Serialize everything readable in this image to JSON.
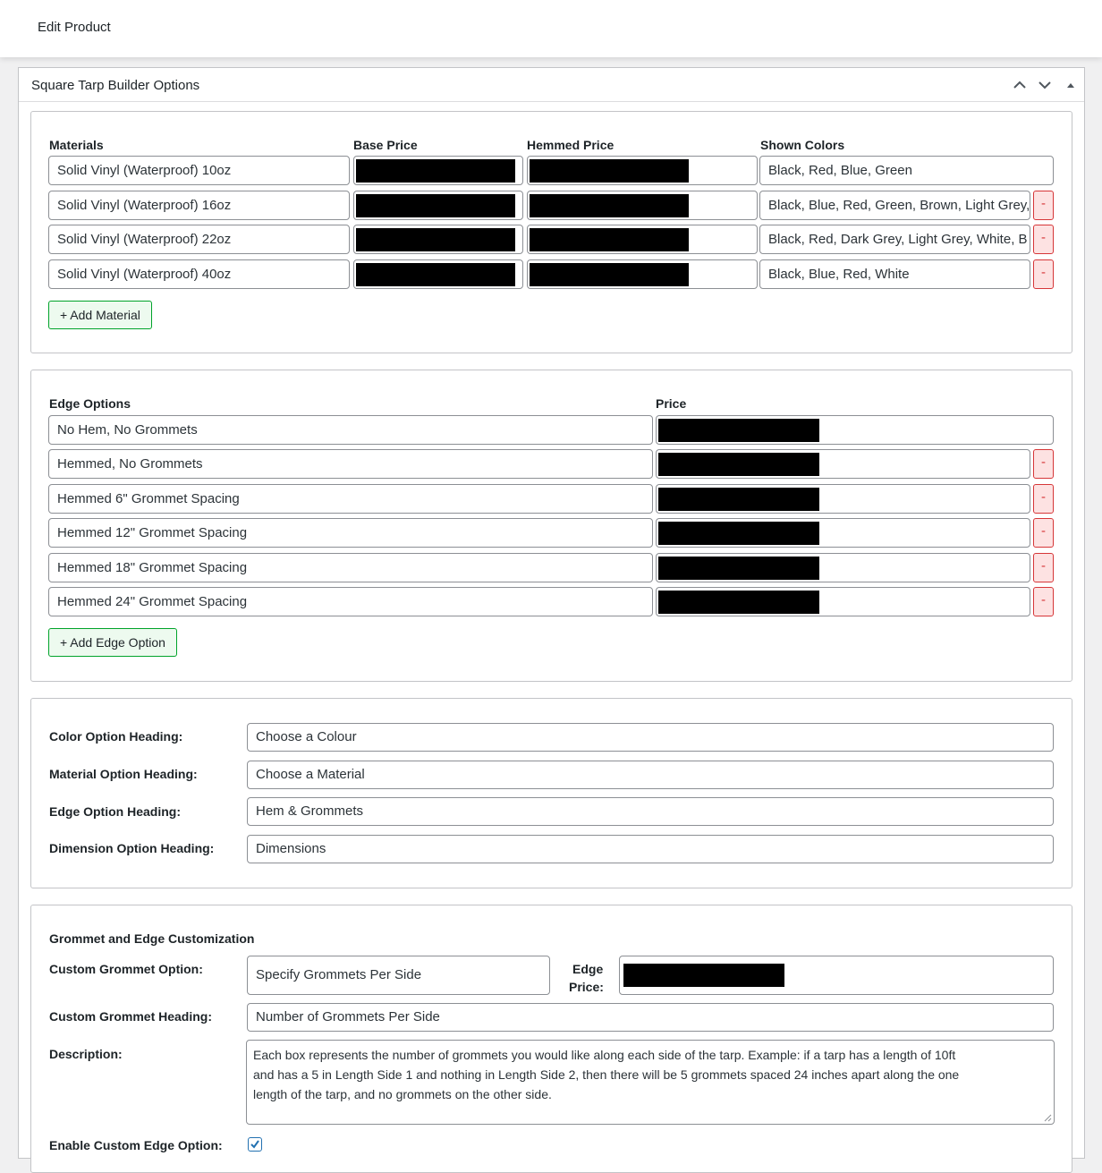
{
  "page": {
    "title": "Edit Product"
  },
  "postbox": {
    "title": "Square Tarp Builder Options",
    "controls": [
      "chevron-up-icon",
      "chevron-down-icon",
      "triangle-up-icon"
    ]
  },
  "materials": {
    "headers": {
      "name": "Materials",
      "base": "Base Price",
      "hemmed": "Hemmed Price",
      "colors": "Shown Colors"
    },
    "rows": [
      {
        "name": "Solid Vinyl (Waterproof) 10oz",
        "colors": "Black, Red, Blue, Green"
      },
      {
        "name": "Solid Vinyl (Waterproof) 16oz",
        "colors": "Black, Blue, Red, Green, Brown, Light Grey,"
      },
      {
        "name": "Solid Vinyl (Waterproof) 22oz",
        "colors": "Black, Red, Dark Grey, Light Grey, White, B"
      },
      {
        "name": "Solid Vinyl (Waterproof) 40oz",
        "colors": "Black, Blue, Red, White"
      }
    ],
    "remove_label": "-",
    "add_label": "+ Add Material"
  },
  "edges": {
    "headers": {
      "name": "Edge Options",
      "price": "Price"
    },
    "rows": [
      {
        "name": "No Hem, No Grommets"
      },
      {
        "name": "Hemmed, No Grommets"
      },
      {
        "name": "Hemmed 6\" Grommet Spacing"
      },
      {
        "name": "Hemmed 12\" Grommet Spacing"
      },
      {
        "name": "Hemmed 18\" Grommet Spacing"
      },
      {
        "name": "Hemmed 24\" Grommet Spacing"
      }
    ],
    "remove_label": "-",
    "add_label": "+ Add Edge Option"
  },
  "headings": {
    "color": {
      "label": "Color Option Heading:",
      "value": "Choose a Colour"
    },
    "material": {
      "label": "Material Option Heading:",
      "value": "Choose a Material"
    },
    "edge": {
      "label": "Edge Option Heading:",
      "value": "Hem & Grommets"
    },
    "dimension": {
      "label": "Dimension Option Heading:",
      "value": "Dimensions"
    }
  },
  "grommet": {
    "section_title": "Grommet and Edge Customization",
    "custom_option_label": "Custom Grommet Option:",
    "custom_option_value": "Specify Grommets Per Side",
    "edge_price_label_1": "Edge",
    "edge_price_label_2": "Price:",
    "custom_heading_label": "Custom Grommet Heading:",
    "custom_heading_value": "Number of Grommets Per Side",
    "description_label": "Description:",
    "description_lines": [
      "Each box represents the number of grommets you would like along each side of the tarp. Example: if a tarp has a length of 10ft",
      "and has a 5 in Length Side 1 and nothing in Length Side 2, then there will be 5 grommets spaced 24 inches apart along the one",
      "length of the tarp, and no grommets on the other side."
    ],
    "enable_custom_edge_label": "Enable Custom Edge Option:",
    "enable_custom_edge_checked": true
  }
}
